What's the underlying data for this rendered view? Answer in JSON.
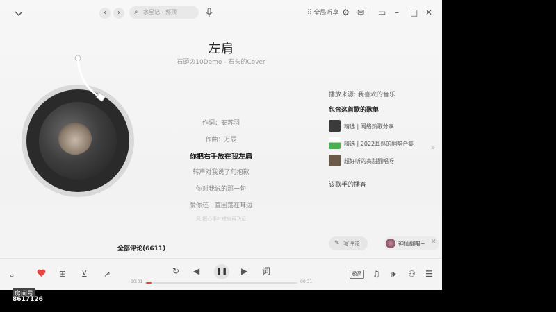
{
  "search": {
    "placeholder": "水星记 - 郭顶"
  },
  "header": {
    "listen_together": "全局听享"
  },
  "song": {
    "title": "左肩",
    "subtitle": "石頭の10Demo - 石头的Cover"
  },
  "lyrics": {
    "lines": [
      "作词：安苏羽",
      "作曲：万辰",
      "你把右手放在我左肩",
      "转声对我说了句抱歉",
      "你对我说的那一句",
      "爱你还一直回荡在耳边",
      "风 把心事叶成就再飞远"
    ]
  },
  "right_panel": {
    "source": "播放来源: 我喜欢的音乐",
    "playlists_title": "包含这首歌的歌单",
    "playlists": [
      {
        "label": "精选 | 网络热歌分享",
        "thumb_color": "#3a3a3a"
      },
      {
        "label": "精选 | 2022耳熟的翻唱合集",
        "thumb_color": "#4caf50"
      },
      {
        "label": "超好听的高甜翻唱呀",
        "thumb_color": "#6b5a4a"
      }
    ],
    "artist_songs": "该歌手的播客",
    "write_comment": "写评论",
    "user_name": "神仙翻唱~"
  },
  "comments": {
    "label": "全部评论(6611)"
  },
  "player": {
    "time_current": "00:01",
    "time_total": "00:31",
    "progress": 0.035,
    "lyric_btn": "词",
    "quality": "极高"
  },
  "watermark": {
    "line1": "房间号",
    "line2": "8617126"
  },
  "colors": {
    "accent": "#e8443e",
    "like": "#e8443e"
  }
}
